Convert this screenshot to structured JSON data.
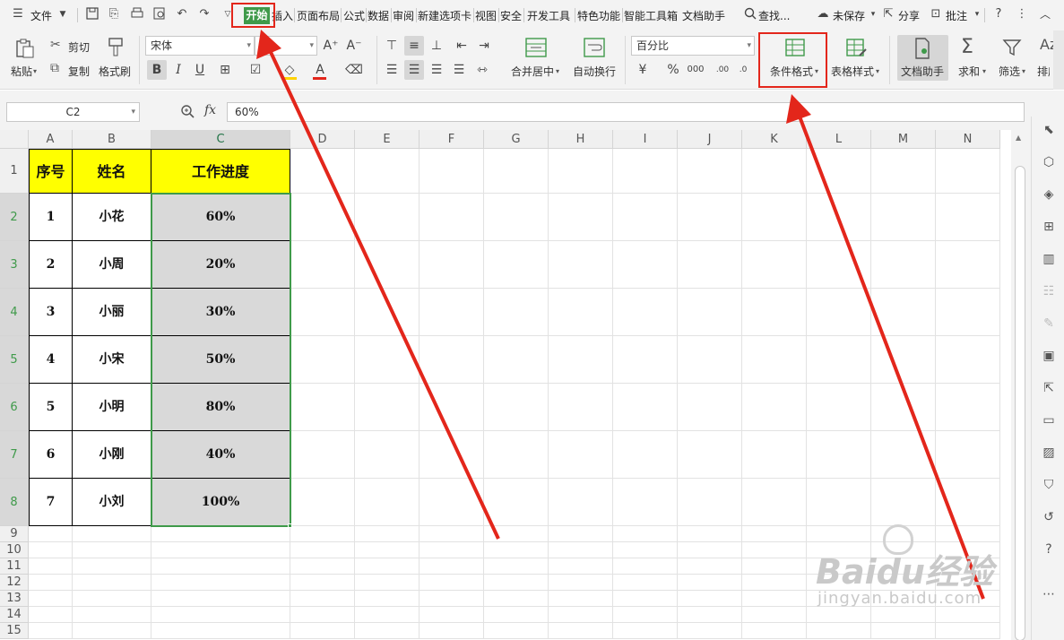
{
  "menubar": {
    "file_label": "文件",
    "tabs": [
      "开始",
      "插入",
      "页面布局",
      "公式",
      "数据",
      "审阅",
      "新建选项卡",
      "视图",
      "安全",
      "开发工具",
      "特色功能",
      "智能工具箱",
      "文档助手"
    ],
    "search_label": "查找...",
    "unsaved_label": "未保存",
    "share_label": "分享",
    "comment_label": "批注"
  },
  "ribbon": {
    "paste_label": "粘贴",
    "cut_label": "剪切",
    "copy_label": "复制",
    "format_painter_label": "格式刷",
    "font_name": "宋体",
    "font_size": "",
    "merge_center_label": "合并居中",
    "wrap_text_label": "自动换行",
    "number_format": "百分比",
    "conditional_format_label": "条件格式",
    "table_style_label": "表格样式",
    "doc_helper_label": "文档助手",
    "sum_label": "求和",
    "filter_label": "筛选",
    "sort_label": "排序"
  },
  "formula_bar": {
    "name_box": "C2",
    "fx_label": "fx",
    "value": "60%"
  },
  "sheet": {
    "columns": [
      "A",
      "B",
      "C",
      "D",
      "E",
      "F",
      "G",
      "H",
      "I",
      "J",
      "K",
      "L",
      "M",
      "N"
    ],
    "rows": [
      "1",
      "2",
      "3",
      "4",
      "5",
      "6",
      "7",
      "8",
      "9",
      "10",
      "11",
      "12",
      "13",
      "14",
      "15"
    ],
    "header": [
      "序号",
      "姓名",
      "工作进度"
    ],
    "data": [
      [
        "1",
        "小花",
        "60%"
      ],
      [
        "2",
        "小周",
        "20%"
      ],
      [
        "3",
        "小丽",
        "30%"
      ],
      [
        "4",
        "小宋",
        "50%"
      ],
      [
        "5",
        "小明",
        "80%"
      ],
      [
        "6",
        "小刚",
        "40%"
      ],
      [
        "7",
        "小刘",
        "100%"
      ]
    ],
    "selected_cell": "C2"
  },
  "watermark": {
    "brand": "Baidu经验",
    "url": "jingyan.baidu.com"
  },
  "colors": {
    "accent": "#3f9a4a",
    "header_fill": "#ffff00",
    "selection_fill": "#d9d9d9",
    "annotation_red": "#e3261b"
  }
}
